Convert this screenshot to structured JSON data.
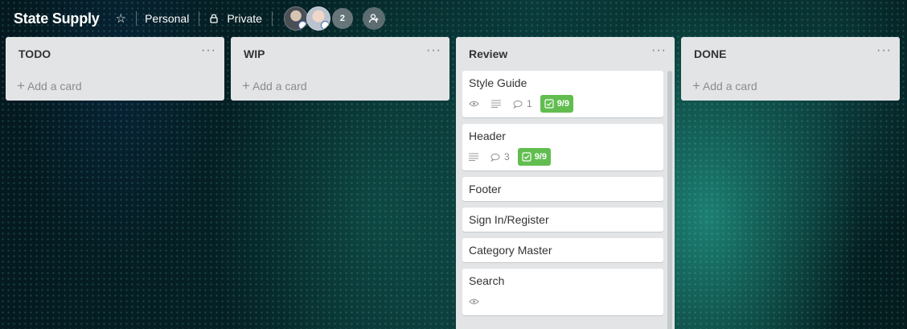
{
  "board": {
    "title": "State Supply",
    "visibility_team": "Personal",
    "visibility_privacy": "Private",
    "member_count": "2"
  },
  "lists": [
    {
      "title": "TODO",
      "add_card": "Add a card",
      "menu": "···"
    },
    {
      "title": "WIP",
      "add_card": "Add a card",
      "menu": "···"
    },
    {
      "title": "Review",
      "menu": "···",
      "cards": [
        {
          "title": "Style Guide",
          "comments": "1",
          "checklist": "9/9"
        },
        {
          "title": "Header",
          "comments": "3",
          "checklist": "9/9"
        },
        {
          "title": "Footer"
        },
        {
          "title": "Sign In/Register"
        },
        {
          "title": "Category Master"
        },
        {
          "title": "Search"
        }
      ]
    },
    {
      "title": "DONE",
      "add_card": "Add a card",
      "menu": "···"
    }
  ],
  "icons": {
    "star": "star-icon",
    "lock": "lock-icon",
    "add_member": "add-member-icon",
    "watch": "eye-icon",
    "description": "description-icon",
    "comment": "comment-icon",
    "checklist": "checklist-icon"
  },
  "colors": {
    "list_bg": "#e2e4e6",
    "checklist_complete": "#61bd4f"
  }
}
